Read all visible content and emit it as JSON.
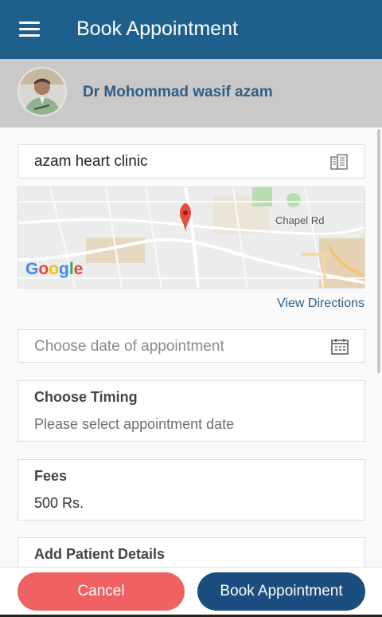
{
  "appbar": {
    "title": "Book Appointment",
    "menu_icon": "hamburger-menu-icon"
  },
  "doctor": {
    "name": "Dr Mohommad wasif azam",
    "avatar": "doctor-avatar"
  },
  "clinic": {
    "name": "azam heart clinic",
    "icon": "building-icon"
  },
  "map": {
    "road_label": "Chapel Rd",
    "logo_text": "Google",
    "pin_icon": "map-pin-icon",
    "brand_colors": [
      "#4285f4",
      "#ea4335",
      "#fbbc05",
      "#4285f4",
      "#34a853",
      "#ea4335"
    ]
  },
  "directions": {
    "label": "View Directions"
  },
  "date": {
    "placeholder": "Choose date of appointment",
    "icon": "calendar-icon"
  },
  "timing": {
    "label": "Choose Timing",
    "value": "Please select appointment date"
  },
  "fees": {
    "label": "Fees",
    "value": "500 Rs."
  },
  "patient": {
    "label": "Add Patient Details"
  },
  "actions": {
    "cancel_label": "Cancel",
    "book_label": "Book Appointment"
  },
  "colors": {
    "primary": "#1f5f8b",
    "cancel": "#f06262",
    "book": "#1b4d7e"
  }
}
